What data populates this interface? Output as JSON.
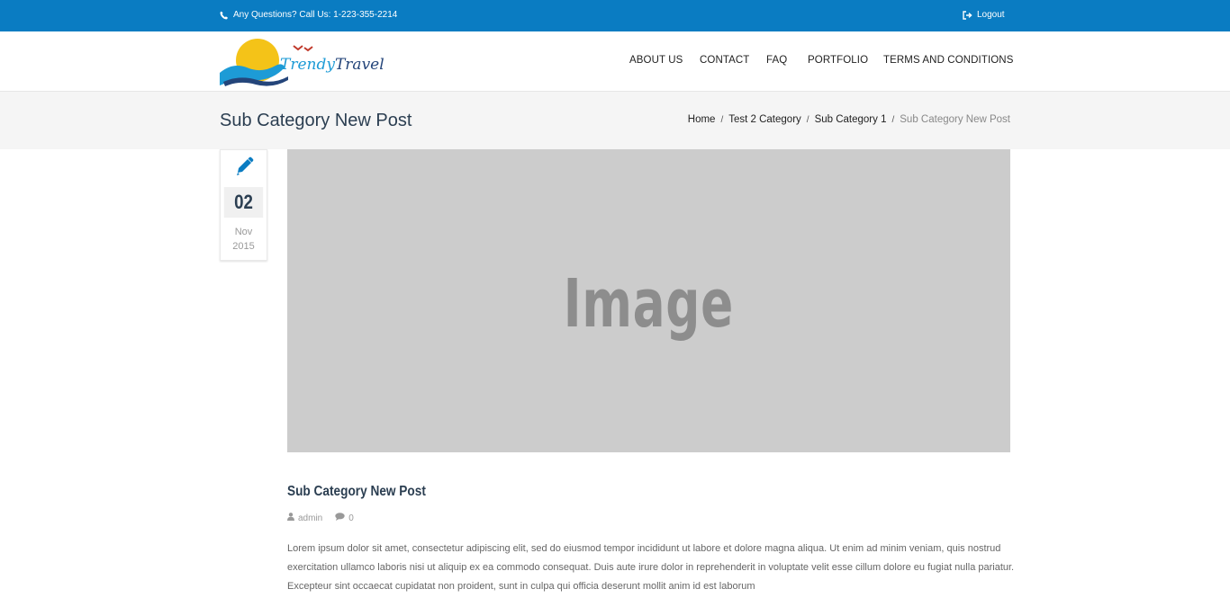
{
  "topbar": {
    "call_text": "Any Questions? Call Us: 1-223-355-2214",
    "logout_label": "Logout",
    "color": "#0a7cc2"
  },
  "brand": {
    "name_part1": "Trendy",
    "name_part2": "Travel"
  },
  "nav": [
    {
      "label": "ABOUT US"
    },
    {
      "label": "CONTACT"
    },
    {
      "label": "FAQ"
    },
    {
      "label": "PORTFOLIO"
    },
    {
      "label": "TERMS AND CONDITIONS"
    }
  ],
  "page": {
    "title": "Sub Category New Post",
    "breadcrumb": [
      "Home",
      "Test 2 Category",
      "Sub Category 1",
      "Sub Category New Post"
    ],
    "breadcrumb_sep": "/"
  },
  "post": {
    "icon": "pencil-icon",
    "day": "02",
    "month": "Nov",
    "year": "2015",
    "image_placeholder": "Image",
    "title": "Sub Category New Post",
    "author": "admin",
    "comments": "0",
    "excerpt": "Lorem ipsum dolor sit amet, consectetur adipiscing elit, sed do eiusmod tempor incididunt ut labore et dolore magna aliqua. Ut enim ad minim veniam, quis nostrud exercitation ullamco laboris nisi ut aliquip ex ea commodo consequat. Duis aute irure dolor in reprehenderit in voluptate velit esse cillum dolore eu fugiat nulla pariatur. Excepteur sint occaecat cupidatat non proident, sunt in culpa qui officia deserunt mollit anim id est laborum"
  }
}
